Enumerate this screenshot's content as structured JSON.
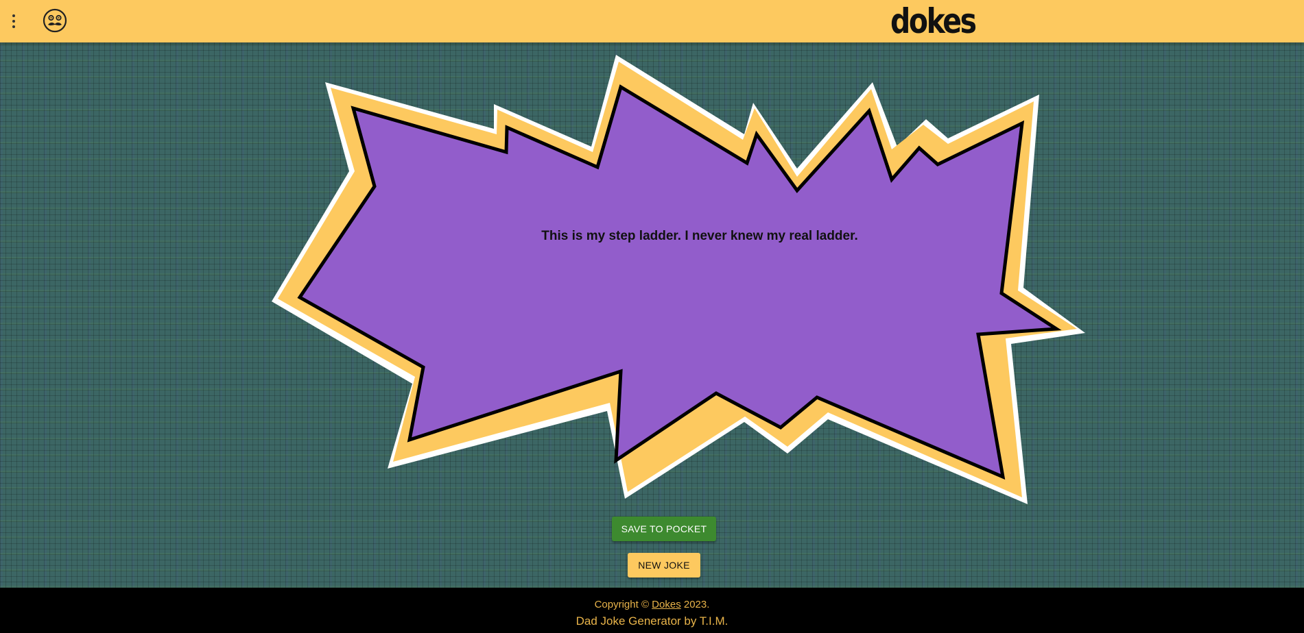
{
  "header": {
    "menu_icon": "more-vertical-icon",
    "logo_icon": "mustache-face-icon",
    "brand": "dokes"
  },
  "joke": {
    "text": "This is my step ladder. I never knew my real ladder."
  },
  "buttons": {
    "save_label": "SAVE TO POCKET",
    "new_joke_label": "NEW JOKE"
  },
  "footer": {
    "copyright_prefix": "Copyright ©",
    "copyright_link": "Dokes",
    "copyright_year": "2023.",
    "tagline": "Dad Joke Generator by T.I.M."
  },
  "colors": {
    "header_bg": "#fdc95f",
    "burst_fill": "#925dcb",
    "burst_outline": "#fdc95f",
    "save_button": "#3d8a2f",
    "footer_text": "#e9b44a"
  }
}
